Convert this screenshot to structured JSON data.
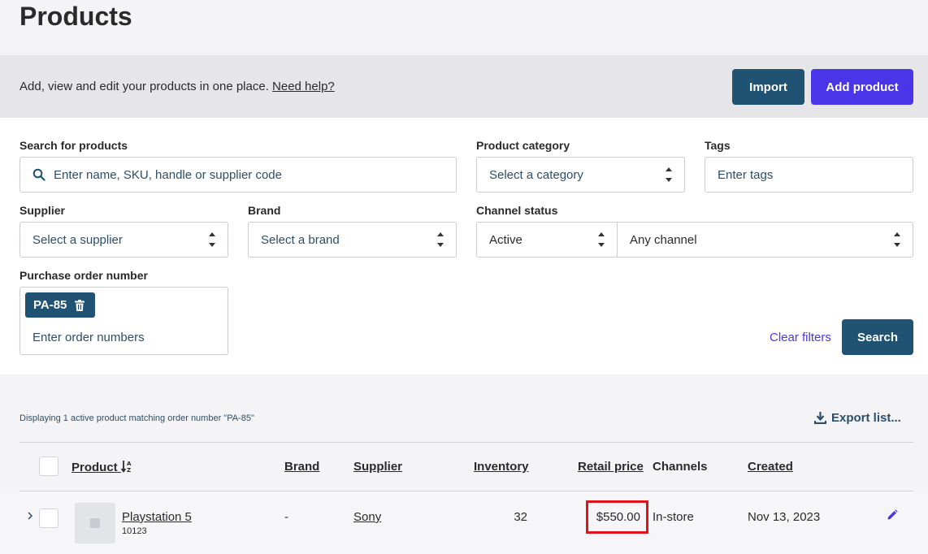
{
  "header": {
    "title": "Products"
  },
  "banner": {
    "text": "Add, view and edit your products in one place.",
    "help_link": "Need help?",
    "import_label": "Import",
    "add_label": "Add product"
  },
  "filters": {
    "search_label": "Search for products",
    "search_placeholder": "Enter name, SKU, handle or supplier code",
    "category_label": "Product category",
    "category_value": "Select a category",
    "tags_label": "Tags",
    "tags_placeholder": "Enter tags",
    "supplier_label": "Supplier",
    "supplier_value": "Select a supplier",
    "brand_label": "Brand",
    "brand_value": "Select a brand",
    "channel_status_label": "Channel status",
    "status_value": "Active",
    "channel_value": "Any channel",
    "po_label": "Purchase order number",
    "po_chip": "PA-85",
    "po_placeholder": "Enter order numbers",
    "clear_label": "Clear filters",
    "search_button": "Search"
  },
  "results": {
    "info": "Displaying 1 active product matching order number \"PA-85\"",
    "export_label": "Export list..."
  },
  "table": {
    "columns": {
      "product": "Product",
      "brand": "Brand",
      "supplier": "Supplier",
      "inventory": "Inventory",
      "retail_price": "Retail price",
      "channels": "Channels",
      "created": "Created"
    },
    "rows": [
      {
        "name": "Playstation 5",
        "sku": "10123",
        "brand": "-",
        "supplier": "Sony",
        "inventory": "32",
        "retail_price": "$550.00",
        "channels": "In-store",
        "created": "Nov 13, 2023"
      }
    ]
  },
  "colors": {
    "primary_dark": "#1f5273",
    "accent": "#4a36e8",
    "highlight": "#e0121c"
  },
  "icons": [
    "search-icon",
    "trash-icon",
    "caret-updown-icon",
    "download-icon",
    "sort-az-icon",
    "chevron-right-icon",
    "image-placeholder-icon",
    "edit-pencil-icon"
  ]
}
